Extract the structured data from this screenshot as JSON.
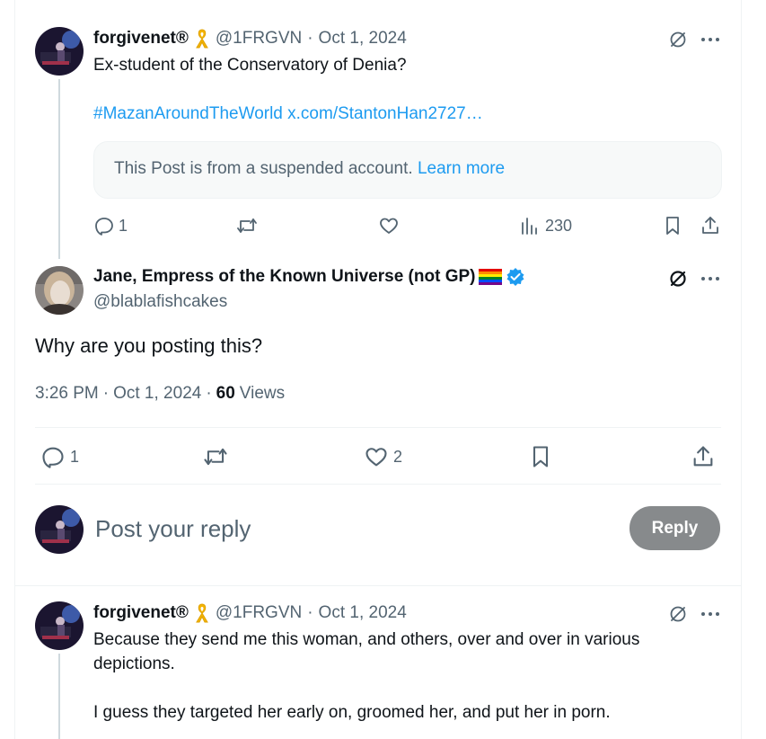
{
  "post1": {
    "name": "forgivenet®",
    "badge_icon": "yellow-ribbon-icon",
    "handle": "@1FRGVN",
    "sep": "·",
    "date": "Oct 1, 2024",
    "text": "Ex-student of the Conservatory of Denia?",
    "hashtag": "#MazanAroundTheWorld",
    "link": "x.com/StantonHan2727…",
    "notice_text": "This Post is from a suspended account.",
    "notice_link": "Learn more",
    "replies": "1",
    "views": "230"
  },
  "post2": {
    "name": "Jane, Empress of the Known Universe (not GP)",
    "flag_icon": "rainbow-flag-icon",
    "verified_icon": "verified-badge-icon",
    "handle": "@blablafishcakes",
    "text": "Why are you posting this?",
    "time": "3:26 PM",
    "sep": "·",
    "date": "Oct 1, 2024",
    "sep2": "·",
    "views_count": "60",
    "views_label": "Views",
    "replies": "1",
    "likes": "2"
  },
  "composer": {
    "placeholder": "Post your reply",
    "button": "Reply"
  },
  "post3": {
    "name": "forgivenet®",
    "handle": "@1FRGVN",
    "sep": "·",
    "date": "Oct 1, 2024",
    "text1": "Because they send me this woman, and others, over and over in various depictions.",
    "text2": "I guess they targeted her early on, groomed her, and put her in porn."
  },
  "colors": {
    "accent": "#1d9bf0",
    "text": "#0f1419",
    "secondary": "#536471",
    "reply_button": "#878a8c"
  }
}
